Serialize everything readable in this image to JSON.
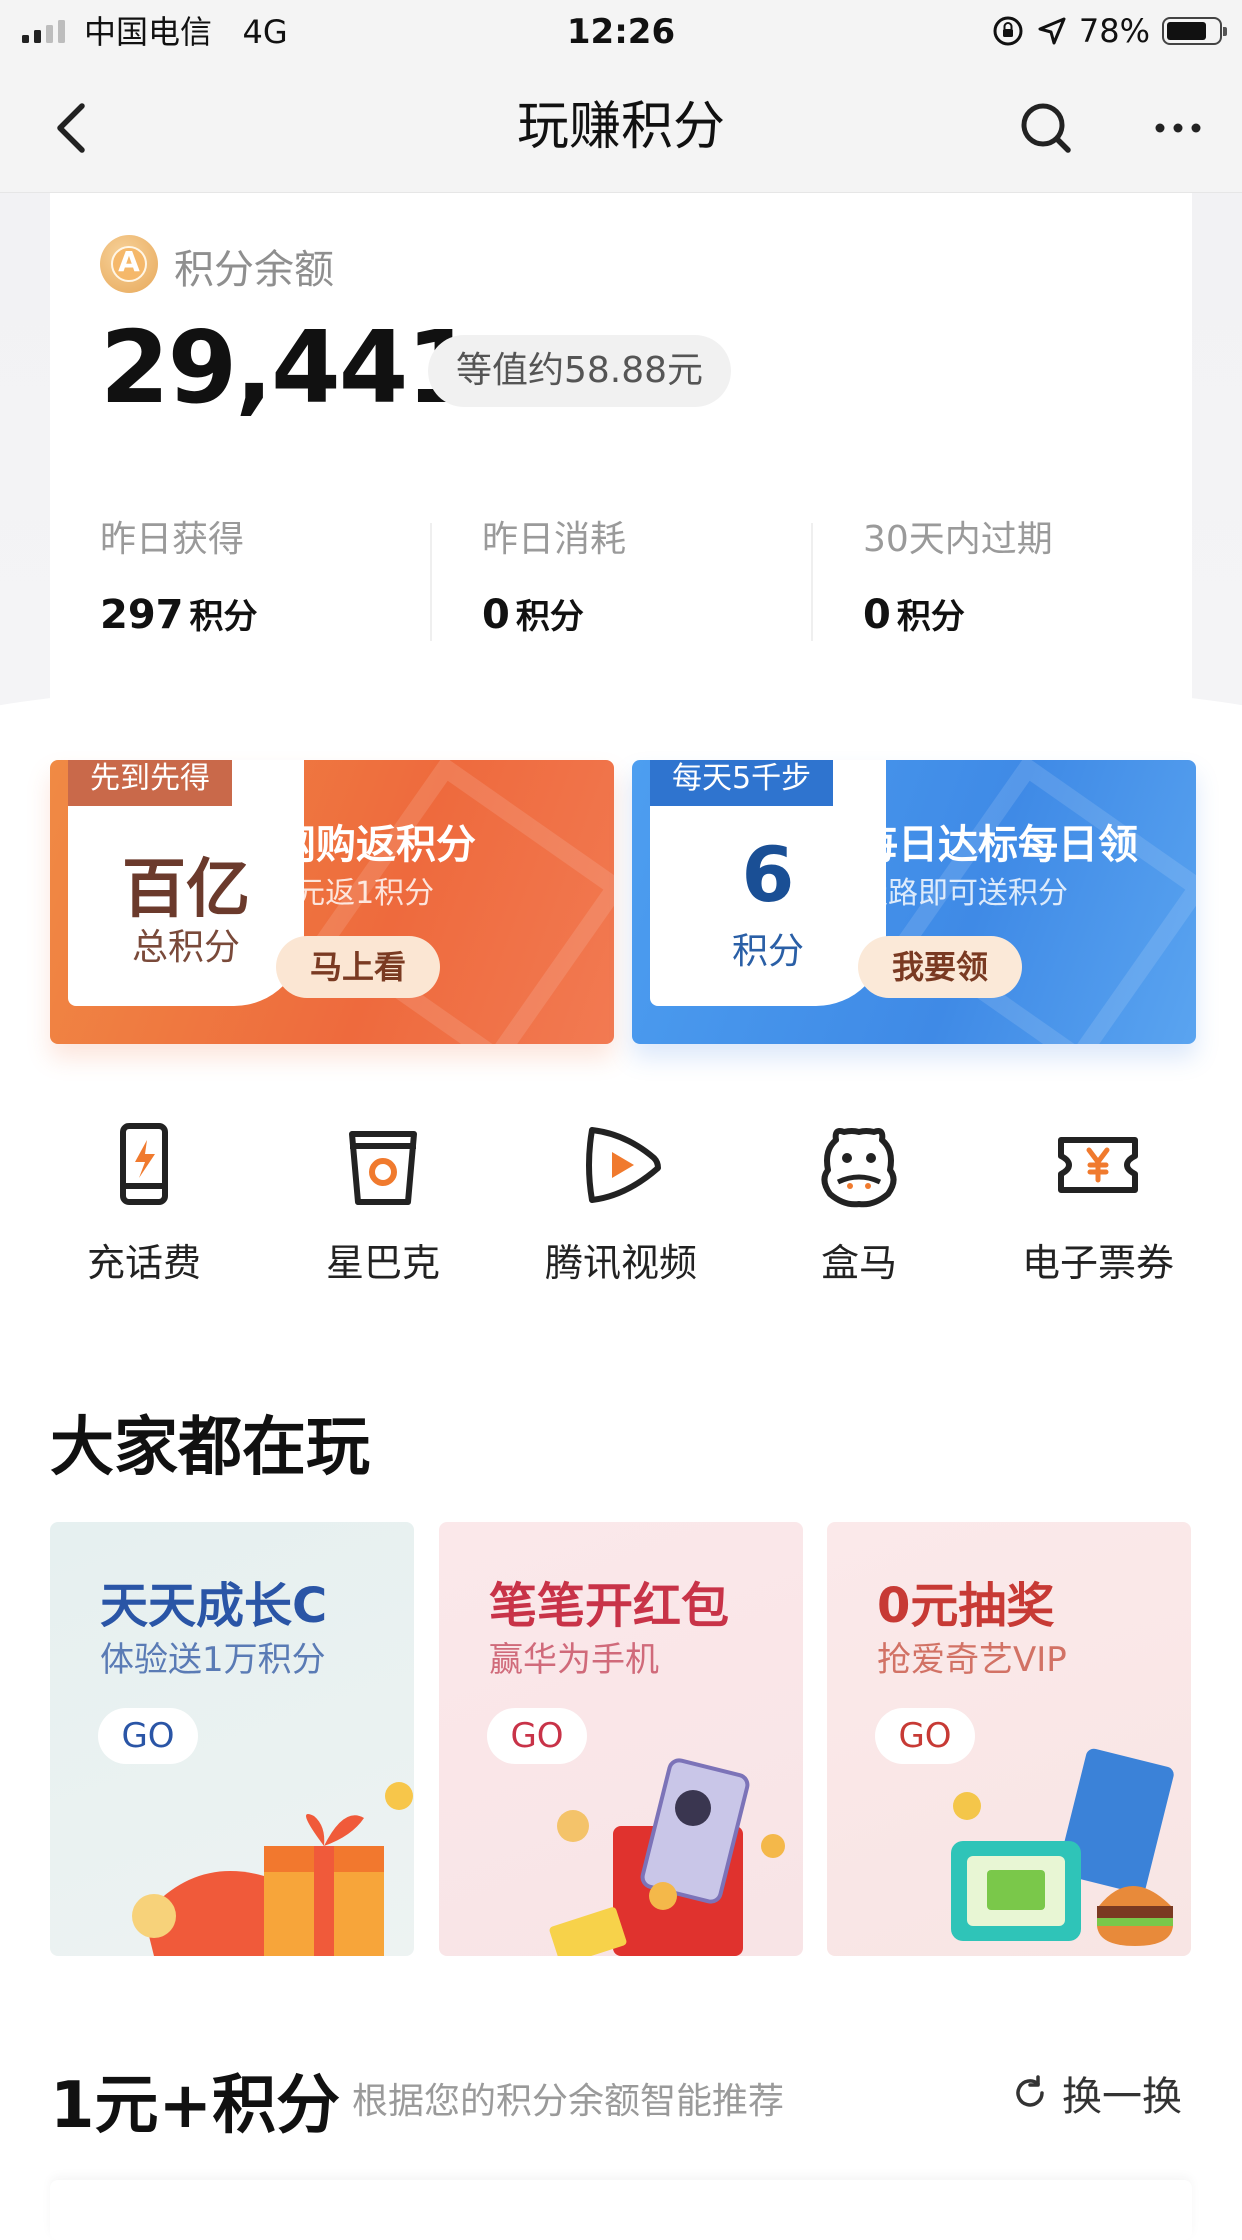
{
  "status_bar": {
    "carrier": "中国电信",
    "network": "4G",
    "time": "12:26",
    "battery": "78%",
    "battery_level": 0.78
  },
  "nav": {
    "title": "玩赚积分"
  },
  "balance": {
    "label": "积分余额",
    "coin_glyph": "A",
    "value": "29,441",
    "equiv": "等值约58.88元",
    "stats": [
      {
        "label": "昨日获得",
        "value": "297",
        "unit": "积分"
      },
      {
        "label": "昨日消耗",
        "value": "0",
        "unit": "积分"
      },
      {
        "label": "30天内过期",
        "value": "0",
        "unit": "积分"
      }
    ]
  },
  "promos": [
    {
      "tag": "先到先得",
      "big": "百亿",
      "small": "总积分",
      "head": "网购返积分",
      "sub": "1元返1积分",
      "cta": "马上看"
    },
    {
      "tag": "每天5千步",
      "big": "6",
      "small": "积分",
      "head": "每日达标每日领",
      "sub": "走路即可送积分",
      "cta": "我要领"
    }
  ],
  "shortcuts": [
    {
      "label": "充话费",
      "icon": "phone-recharge-icon"
    },
    {
      "label": "星巴克",
      "icon": "coffee-cup-icon"
    },
    {
      "label": "腾讯视频",
      "icon": "video-play-icon"
    },
    {
      "label": "盒马",
      "icon": "hippo-icon"
    },
    {
      "label": "电子票券",
      "icon": "ticket-yuan-icon"
    }
  ],
  "popular": {
    "title": "大家都在玩",
    "cards": [
      {
        "title": "天天成长C",
        "subtitle": "体验送1万积分",
        "go": "GO"
      },
      {
        "title": "笔笔开红包",
        "subtitle": "赢华为手机",
        "go": "GO"
      },
      {
        "title": "0元抽奖",
        "subtitle": "抢爱奇艺VIP",
        "go": "GO"
      }
    ]
  },
  "one_yuan": {
    "title": "1元+积分",
    "subtitle": "根据您的积分余额智能推荐",
    "refresh": "换一换"
  },
  "colors": {
    "orange": "#ee6a3d",
    "blue": "#3f8ae6",
    "nav_bg": "#f4f4f4"
  }
}
